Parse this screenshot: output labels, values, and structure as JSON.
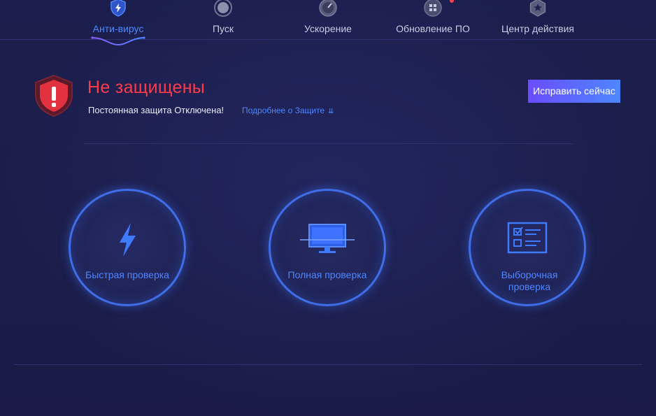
{
  "colors": {
    "background": "#1b1e4a",
    "accent": "#4f86ff",
    "danger": "#ff3b4a",
    "button_gradient_start": "#6a4dff",
    "button_gradient_end": "#4e86ff"
  },
  "nav": {
    "tabs": [
      {
        "label": "Анти-вирус",
        "icon": "shield-bolt-icon",
        "active": true
      },
      {
        "label": "Пуск",
        "icon": "boost-circle-icon",
        "active": false
      },
      {
        "label": "Ускорение",
        "icon": "speedometer-icon",
        "active": false
      },
      {
        "label": "Обновление ПО",
        "icon": "apps-grid-icon",
        "active": false,
        "notification": true
      },
      {
        "label": "Центр действия",
        "icon": "hexagon-star-icon",
        "active": false
      }
    ]
  },
  "status": {
    "icon": "warning-shield-icon",
    "title": "Не защищены",
    "description": "Постоянная защита Отключена!",
    "link": "Подробнее о Защите",
    "fix_button": "Исправить сейчас"
  },
  "scans": [
    {
      "label": "Быстрая проверка",
      "icon": "lightning-icon"
    },
    {
      "label": "Полная проверка",
      "icon": "monitor-icon"
    },
    {
      "label": "Выборочная проверка",
      "icon": "checklist-icon"
    }
  ]
}
